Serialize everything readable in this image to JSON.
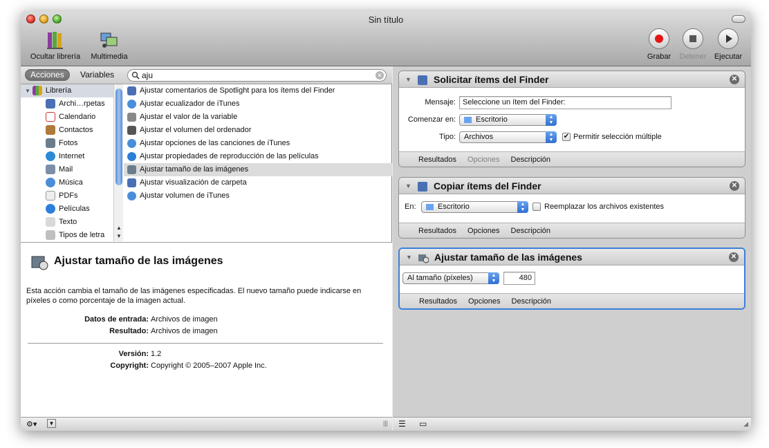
{
  "window": {
    "title": "Sin título"
  },
  "toolbar": {
    "hide_library": "Ocultar librería",
    "media": "Multimedia",
    "record": "Grabar",
    "stop": "Detener",
    "run": "Ejecutar"
  },
  "search": {
    "seg_actions": "Acciones",
    "seg_variables": "Variables",
    "query": "aju"
  },
  "library": {
    "header": "Librería",
    "items": [
      "Archi…rpetas",
      "Calendario",
      "Contactos",
      "Fotos",
      "Internet",
      "Mail",
      "Música",
      "PDFs",
      "Películas",
      "Texto",
      "Tipos de letra"
    ]
  },
  "actions": [
    "Ajustar comentarios de Spotlight para los ítems del Finder",
    "Ajustar ecualizador de iTunes",
    "Ajustar el valor de la variable",
    "Ajustar el volumen del ordenador",
    "Ajustar opciones de las canciones de iTunes",
    "Ajustar propiedades de reproducción de las películas",
    "Ajustar tamaño de las imágenes",
    "Ajustar visualización de carpeta",
    "Ajustar volumen de iTunes"
  ],
  "description": {
    "title": "Ajustar tamaño de las imágenes",
    "text": "Esta acción cambia el tamaño de las imágenes especificadas. El nuevo tamaño puede indicarse en píxeles o como porcentaje de la imagen actual.",
    "input_label": "Datos de entrada:",
    "input_value": "Archivos de imagen",
    "result_label": "Resultado:",
    "result_value": "Archivos de imagen",
    "version_label": "Versión:",
    "version_value": "1.2",
    "copyright_label": "Copyright:",
    "copyright_value": "Copyright © 2005–2007 Apple Inc."
  },
  "workflow": {
    "card1": {
      "title": "Solicitar ítems del Finder",
      "message_label": "Mensaje:",
      "message_value": "Seleccione un ítem del Finder:",
      "start_label": "Comenzar en:",
      "start_value": "Escritorio",
      "type_label": "Tipo:",
      "type_value": "Archivos",
      "multi_label": "Permitir selección múltiple",
      "multi_checked": true
    },
    "card2": {
      "title": "Copiar ítems del Finder",
      "to_label": "En:",
      "to_value": "Escritorio",
      "replace_label": "Reemplazar los archivos existentes",
      "replace_checked": false
    },
    "card3": {
      "title": "Ajustar tamaño de las imágenes",
      "mode_value": "Al tamaño (píxeles)",
      "size_value": "480"
    },
    "tabs": {
      "results": "Resultados",
      "options": "Opciones",
      "description": "Descripción"
    }
  }
}
